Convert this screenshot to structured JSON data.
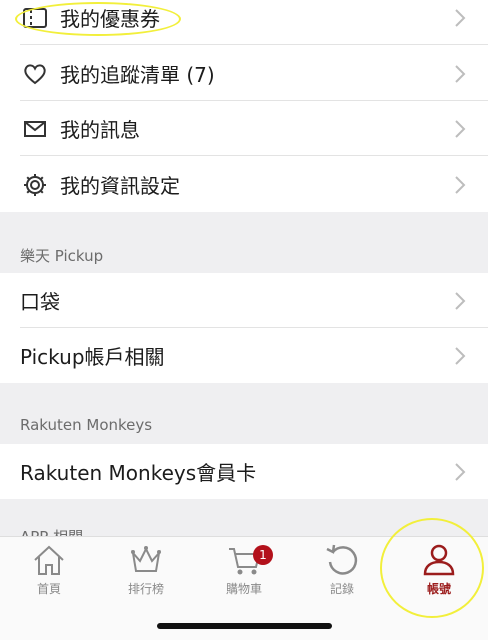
{
  "account_menu": {
    "items": [
      {
        "label": "我的優惠券",
        "icon": "coupon-icon"
      },
      {
        "label": "我的追蹤清單 (7)",
        "icon": "heart-icon"
      },
      {
        "label": "我的訊息",
        "icon": "mail-icon"
      },
      {
        "label": "我的資訊設定",
        "icon": "gear-icon"
      }
    ]
  },
  "pickup_section": {
    "header": "樂天 Pickup",
    "items": [
      {
        "label": "口袋"
      },
      {
        "label": "Pickup帳戶相關"
      }
    ]
  },
  "monkeys_section": {
    "header": "Rakuten Monkeys",
    "items": [
      {
        "label": "Rakuten Monkeys會員卡"
      }
    ]
  },
  "partial_section_header": "APP 相關",
  "tabbar": {
    "tabs": [
      {
        "label": "首頁",
        "icon": "home-icon"
      },
      {
        "label": "排行榜",
        "icon": "crown-icon"
      },
      {
        "label": "購物車",
        "icon": "cart-icon",
        "badge": "1"
      },
      {
        "label": "記錄",
        "icon": "history-icon"
      },
      {
        "label": "帳號",
        "icon": "user-icon",
        "active": true
      }
    ]
  },
  "colors": {
    "accent": "#9b1c1c",
    "badge": "#b3111b",
    "section_background": "#efeff1",
    "highlight_marker": "#f2ef3b"
  }
}
